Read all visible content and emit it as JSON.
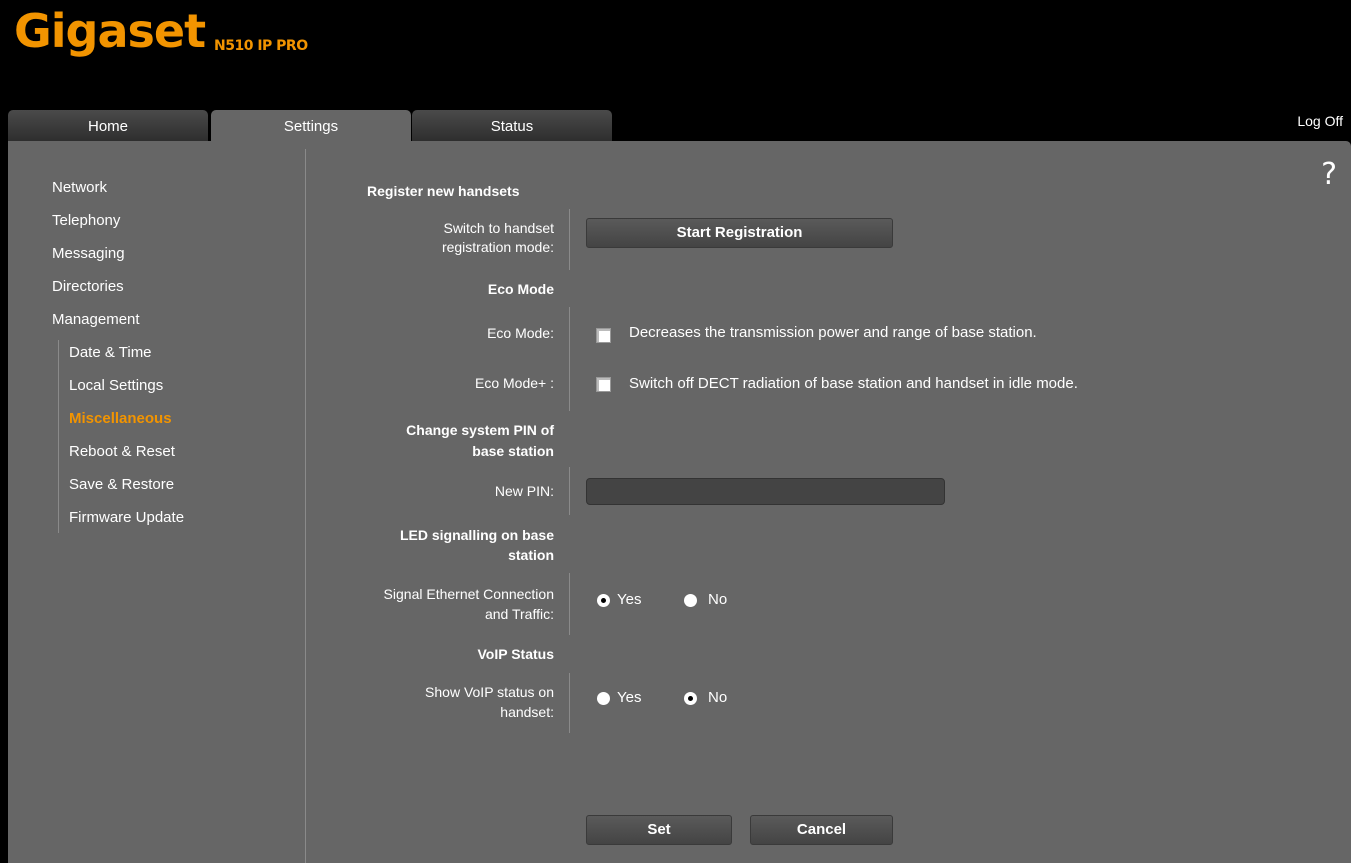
{
  "header": {
    "logo": "Gigaset",
    "model": "N510 IP PRO",
    "logoff": "Log Off",
    "help": "?"
  },
  "tabs": [
    "Home",
    "Settings",
    "Status"
  ],
  "active_tab": "Settings",
  "sidebar": {
    "items": [
      "Network",
      "Telephony",
      "Messaging",
      "Directories",
      "Management"
    ],
    "subitems": [
      "Date & Time",
      "Local Settings",
      "Miscellaneous",
      "Reboot & Reset",
      "Save & Restore",
      "Firmware Update"
    ],
    "current": "Miscellaneous"
  },
  "form": {
    "register": {
      "heading": "Register new handsets",
      "label_line1": "Switch to handset",
      "label_line2": "registration mode:",
      "button": "Start Registration"
    },
    "eco": {
      "heading": "Eco Mode",
      "eco_label": "Eco Mode:",
      "eco_desc": "Decreases the transmission power and range of base station.",
      "eco_checked": false,
      "ecoplus_label": "Eco Mode+ :",
      "ecoplus_desc": "Switch off DECT radiation of base station and handset in idle mode.",
      "ecoplus_checked": false
    },
    "pin": {
      "heading_line1": "Change system PIN of",
      "heading_line2": "base station",
      "label": "New PIN:",
      "value": ""
    },
    "led": {
      "heading_line1": "LED signalling on base",
      "heading_line2": "station",
      "label_line1": "Signal Ethernet Connection",
      "label_line2": "and Traffic:",
      "yes": "Yes",
      "no": "No",
      "selected": "Yes"
    },
    "voip": {
      "heading": "VoIP Status",
      "label_line1": "Show VoIP status on",
      "label_line2": "handset:",
      "yes": "Yes",
      "no": "No",
      "selected": "No"
    },
    "buttons": {
      "set": "Set",
      "cancel": "Cancel"
    }
  }
}
